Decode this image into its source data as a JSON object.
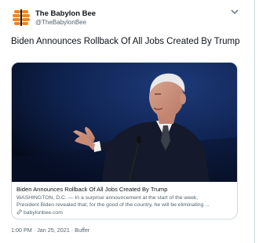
{
  "tweet": {
    "author_name": "The Babylon Bee",
    "author_handle": "@TheBabylonBee",
    "text": "Biden Announces Rollback Of All Jobs Created By Trump",
    "more_icon": "chevron-down-icon"
  },
  "card": {
    "title": "Biden Announces Rollback Of All Jobs Created By Trump",
    "description_line1": "WASHINGTON, D.C. — In a surprise announcement at the start of the week,",
    "description_line2": "President Biden revealed that, for the good of the country, he will be eliminating ...",
    "domain": "babylonbee.com",
    "domain_icon": "link-icon"
  },
  "footer": {
    "time": "1:00 PM",
    "separator1": "·",
    "date": "Jan 25, 2021",
    "separator2": "·",
    "source": "Buffer"
  },
  "colors": {
    "text": "#0f1419",
    "secondary": "#536471",
    "border": "#cfd9de",
    "logo_orange": "#e8852b",
    "photo_background": "#0e1b35"
  }
}
